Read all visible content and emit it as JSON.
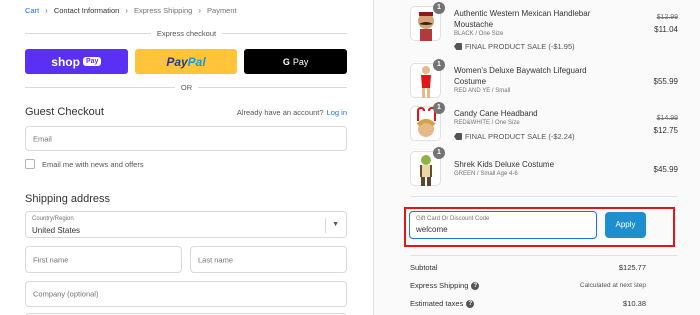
{
  "breadcrumb": [
    {
      "label": "Cart",
      "state": "link"
    },
    {
      "label": "Contact Information",
      "state": "current"
    },
    {
      "label": "Express Shipping",
      "state": "future"
    },
    {
      "label": "Payment",
      "state": "future"
    }
  ],
  "express": {
    "label": "Express checkout",
    "shop_pay": {
      "label": "shop",
      "badge": "Pay"
    },
    "paypal": {
      "pay": "Pay",
      "pal": "Pal"
    },
    "gpay": {
      "g": "G",
      "label": "Pay"
    }
  },
  "or_label": "OR",
  "guest": {
    "title": "Guest Checkout",
    "have_account": "Already have an account?",
    "login": "Log in",
    "email_placeholder": "Email",
    "newsletter_label": "Email me with news and offers"
  },
  "shipping": {
    "title": "Shipping address",
    "country_label": "Country/Region",
    "country_value": "United States",
    "first_name_placeholder": "First name",
    "last_name_placeholder": "Last name",
    "company_placeholder": "Company (optional)"
  },
  "items": [
    {
      "name": "Authentic Western Mexican Handlebar Moustache",
      "variant": "BLACK / One Size",
      "sale": "FINAL PRODUCT SALE (-$1.95)",
      "old_price": "$12.99",
      "price": "$11.04",
      "qty": "1"
    },
    {
      "name": "Women's Deluxe Baywatch Lifeguard Costume",
      "variant": "RED AND YE / Small",
      "price": "$55.99",
      "qty": "1"
    },
    {
      "name": "Candy Cane Headband",
      "variant": "RED&WHITE / One Size",
      "sale": "FINAL PRODUCT SALE (-$2.24)",
      "old_price": "$14.99",
      "price": "$12.75",
      "qty": "1"
    },
    {
      "name": "Shrek Kids Deluxe Costume",
      "variant": "GREEN / Small Age 4-6",
      "price": "$45.99",
      "qty": "1"
    }
  ],
  "discount": {
    "label": "Gift Card Or Discount Code",
    "value": "welcome",
    "apply_label": "Apply"
  },
  "summary": {
    "subtotal_label": "Subtotal",
    "subtotal_value": "$125.77",
    "shipping_label": "Express Shipping",
    "shipping_value": "Calculated at next step",
    "taxes_label": "Estimated taxes",
    "taxes_value": "$10.38"
  },
  "colors": {
    "shop_pay": "#5a31f4",
    "paypal": "#ffc439",
    "gpay": "#000000",
    "apply": "#1e8fce",
    "highlight": "#e3151b",
    "link": "#1a73e8"
  }
}
